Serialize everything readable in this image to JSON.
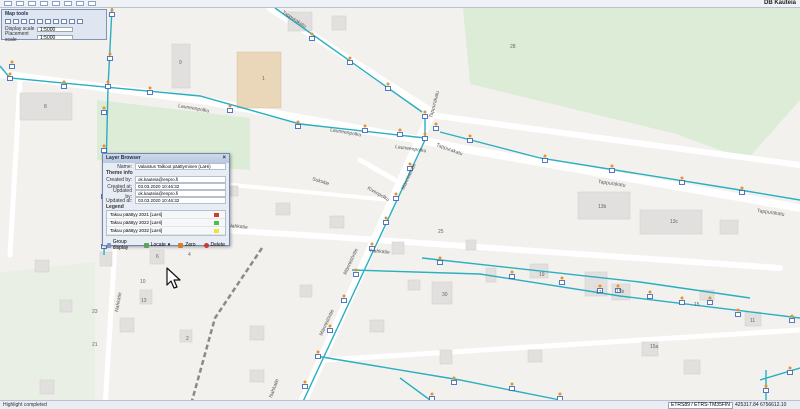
{
  "app": {
    "brand": "DB Kauteia"
  },
  "map_tools": {
    "title": "Map tools",
    "display_scale_label": "Display scale",
    "display_scale_value": "1:5000",
    "placement_scale_label": "Placement scale",
    "placement_scale_value": "1:5000"
  },
  "streets": {
    "tappurakatu": "Tappurakatu",
    "launeenpolku_1": "Launeenpolku",
    "launeenpolku_2": "Launeenpolku",
    "launeenpolku_3": "Launeenpolku",
    "suksitie": "Suksitie",
    "kivenpolku": "Kivenpolku",
    "mannistontie_1": "Männistöntie",
    "mannistontie_2": "Männistöntie",
    "mannistontie_3": "Männistöntie",
    "nahkatie": "Nahkatie",
    "nahkatie_2": "Nahkatie",
    "tappurakatu_2": "Tappurakatu",
    "tappurakatu_3": "Tappurakatu",
    "tappurakatu_4": "Tappurakatu",
    "tappurakatu_5": "Tappurakatu",
    "nahkatie_3": "Nahkatie",
    "nahkatie_4": "Nahkatie"
  },
  "buildings": {
    "b9": "9",
    "b1": "1",
    "b8": "8",
    "b2": "2",
    "b28": "28",
    "b13b": "13b",
    "b13c": "13c",
    "b25": "25",
    "b19": "19",
    "b17": "17",
    "b15b": "15b",
    "b15": "15",
    "b30": "30",
    "b11": "11",
    "b23": "23",
    "b21": "21",
    "b6": "6",
    "b10": "10",
    "b13": "13",
    "b4": "4",
    "b15a": "15a",
    "b2b": "2"
  },
  "dialog": {
    "title": "Layer Browser",
    "name_label": "Name:",
    "name_value": "Valaistus Talkoot päättyminen (LaHi)",
    "theme_info": "Theme info",
    "created_by_label": "Created by:",
    "created_by_value": "ok.kauteia@enpro.fi",
    "created_at_label": "Created at:",
    "created_at_value": "03.03.2020 10:46:32",
    "updated_by_label": "Updated by:",
    "updated_by_value": "ok.kauteia@enpro.fi",
    "updated_at_label": "Updated at:",
    "updated_at_value": "03.03.2020 10:46:32",
    "legend_title": "Legend",
    "legend": [
      {
        "label": "Takuu päättyy 2021 [LaHi]",
        "color": "#d23a2a"
      },
      {
        "label": "Takuu päättyy 2022 [LaHi]",
        "color": "#49c24a"
      },
      {
        "label": "Takuu päättyy 2032 [LaHi]",
        "color": "#f0e23a"
      }
    ],
    "buttons": {
      "group": "Group display",
      "locate": "Locate",
      "zero": "Zero",
      "delete": "Delete"
    }
  },
  "status": {
    "left": "Highlight completed",
    "crs": "ETRS89 / ETRS-TM35FIN",
    "coords": "425317.84 6756612.10"
  },
  "colors": {
    "network": "#2aaec0",
    "lamp": "#e8912e",
    "map_bg": "#f2f1ee",
    "green": "#dcecd6",
    "building": "#e2e0de"
  }
}
